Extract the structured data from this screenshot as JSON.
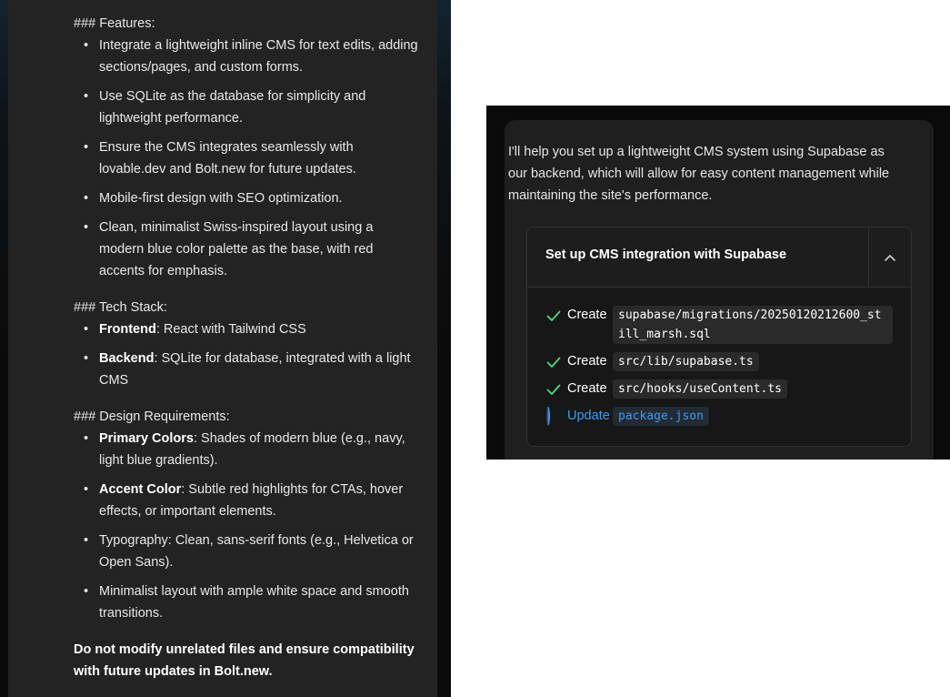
{
  "prompt": {
    "features_heading": "### Features:",
    "features": [
      "Integrate a lightweight inline CMS for text edits, adding sections/pages, and custom forms.",
      "Use SQLite as the database for simplicity and lightweight performance.",
      "Ensure the CMS integrates seamlessly with lovable.dev and Bolt.new for future updates.",
      "Mobile-first design with SEO optimization.",
      "Clean, minimalist Swiss-inspired layout using a modern blue color palette as the base, with red accents for emphasis."
    ],
    "tech_heading": "### Tech Stack:",
    "tech": [
      {
        "label": "Frontend",
        "text": ": React with Tailwind CSS"
      },
      {
        "label": "Backend",
        "text": ": SQLite for database, integrated with a light CMS"
      }
    ],
    "design_heading": "### Design Requirements:",
    "design": [
      {
        "label": "Primary Colors",
        "text": ": Shades of modern blue (e.g., navy, light blue gradients)."
      },
      {
        "label": "Accent Color",
        "text": ": Subtle red highlights for CTAs, hover effects, or important elements."
      }
    ],
    "design_plain": [
      "Typography: Clean, sans-serif fonts (e.g., Helvetica or Open Sans).",
      "Minimalist layout with ample white space and smooth transitions."
    ],
    "closing": "Do not modify unrelated files and ensure compatibility with future updates in Bolt.new."
  },
  "assistant": {
    "message": "I'll help you set up a lightweight CMS system using Supabase as our backend, which will allow for easy content management while maintaining the site's performance.",
    "action_title": "Set up CMS integration with Supabase",
    "collapse_icon": "chevron-up-icon",
    "steps": [
      {
        "status": "done",
        "verb": "Create",
        "path": "supabase/migrations/20250120212600_still_marsh.sql"
      },
      {
        "status": "done",
        "verb": "Create",
        "path": "src/lib/supabase.ts"
      },
      {
        "status": "done",
        "verb": "Create",
        "path": "src/hooks/useContent.ts"
      },
      {
        "status": "in-progress",
        "verb": "Update",
        "path": "package.json"
      }
    ]
  },
  "colors": {
    "success": "#4ade80",
    "active": "#3b9cf5"
  }
}
